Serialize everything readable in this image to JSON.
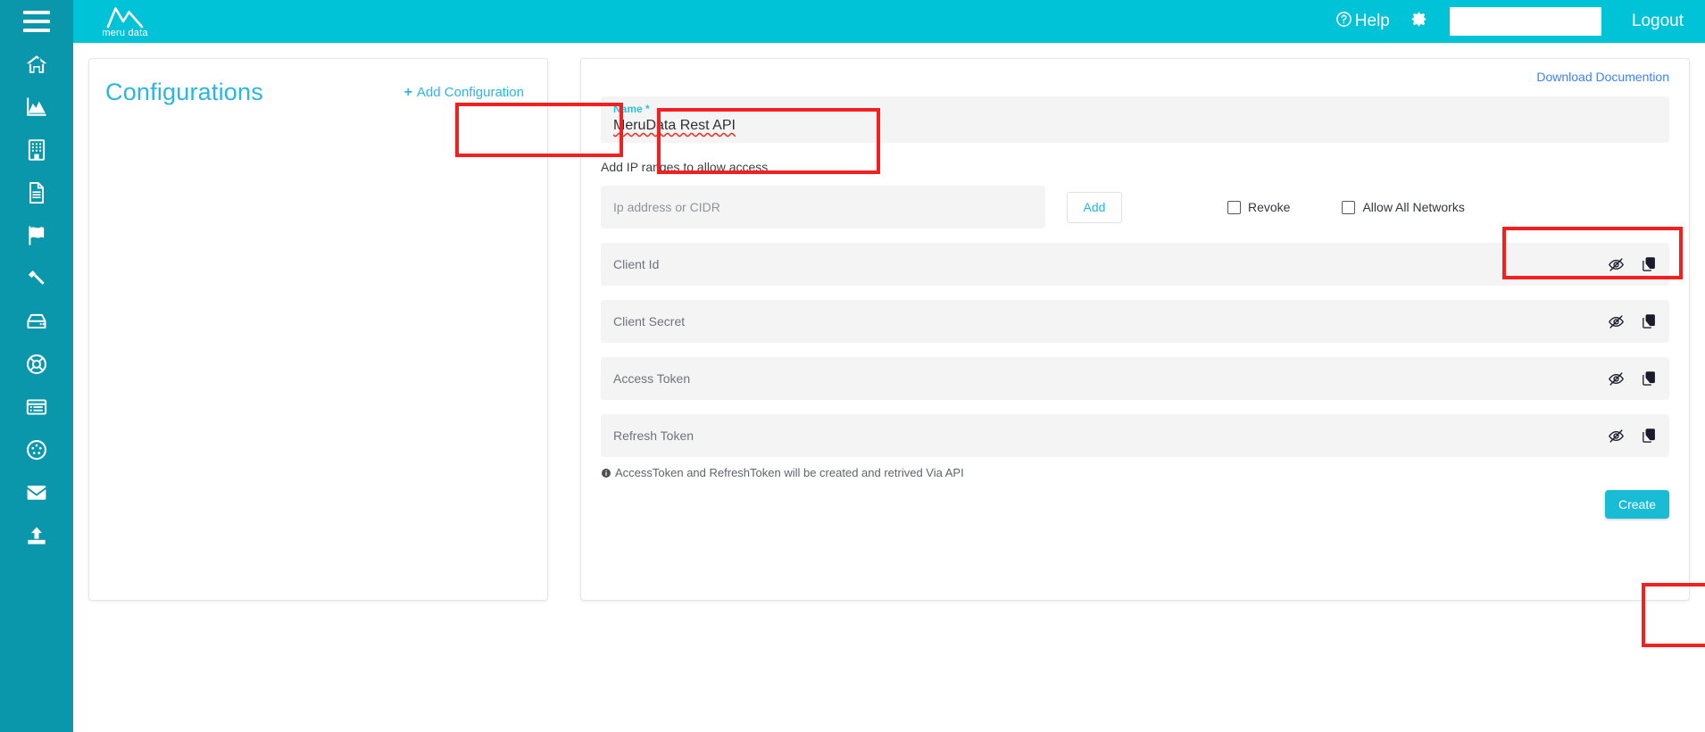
{
  "sidebar": {
    "menu_toggle": "menu-toggle",
    "items": [
      {
        "icon": "home-icon",
        "name": "sidebar-item-home"
      },
      {
        "icon": "area-chart-icon",
        "name": "sidebar-item-analytics"
      },
      {
        "icon": "building-icon",
        "name": "sidebar-item-organization"
      },
      {
        "icon": "document-icon",
        "name": "sidebar-item-documents"
      },
      {
        "icon": "flag-icon",
        "name": "sidebar-item-flags"
      },
      {
        "icon": "gavel-icon",
        "name": "sidebar-item-policies"
      },
      {
        "icon": "server-icon",
        "name": "sidebar-item-datastore"
      },
      {
        "icon": "life-ring-icon",
        "name": "sidebar-item-support"
      },
      {
        "icon": "list-view-icon",
        "name": "sidebar-item-catalog"
      },
      {
        "icon": "disc-icon",
        "name": "sidebar-item-connections"
      },
      {
        "icon": "envelope-icon",
        "name": "sidebar-item-messages"
      },
      {
        "icon": "upload-icon",
        "name": "sidebar-item-upload"
      }
    ]
  },
  "header": {
    "brand_name": "meru data",
    "brand_logo_icon": "meru-mountain-logo",
    "help_label": "Help",
    "help_icon": "question-circle-icon",
    "settings_icon": "gear-icon",
    "search_value": "",
    "search_placeholder": "",
    "logout_label": "Logout"
  },
  "configurations_panel": {
    "title": "Configurations",
    "add_configuration_label": "Add Configuration",
    "add_icon": "plus-icon",
    "empty_list": []
  },
  "detail_panel": {
    "download_documentation_label": "Download Documention",
    "name_label": "Name *",
    "name_value": "MeruData Rest API",
    "ip_section_label": "Add IP ranges to allow access",
    "ip_input_value": "",
    "ip_input_placeholder": "Ip address or CIDR",
    "add_button_label": "Add",
    "checkboxes": [
      {
        "label": "Revoke",
        "checked": false,
        "name": "revoke-checkbox"
      },
      {
        "label": "Allow All Networks",
        "checked": false,
        "name": "allow-all-networks-checkbox"
      }
    ],
    "token_rows": [
      {
        "label": "Client Id",
        "value": ""
      },
      {
        "label": "Client Secret",
        "value": ""
      },
      {
        "label": "Access Token",
        "value": ""
      },
      {
        "label": "Refresh Token",
        "value": ""
      }
    ],
    "row_icons": {
      "visibility": "eye-slash-icon",
      "copy": "copy-icon"
    },
    "note_icon": "info-circle-icon",
    "note_text": "AccessToken and RefreshToken will be created and retrived Via API",
    "create_button_label": "Create"
  },
  "annotations": {
    "highlight_color": "#f42020",
    "boxes": [
      "add-configuration-button",
      "name-field",
      "allow-all-networks-checkbox",
      "create-button"
    ]
  },
  "colors": {
    "header_cyan": "#00c3d8",
    "sidebar_teal": "#0b97ab",
    "accent_link": "#29b6e8",
    "field_grey": "#f4f4f5",
    "doc_link_blue": "#3b82f6",
    "create_button": "#18bcd4"
  }
}
